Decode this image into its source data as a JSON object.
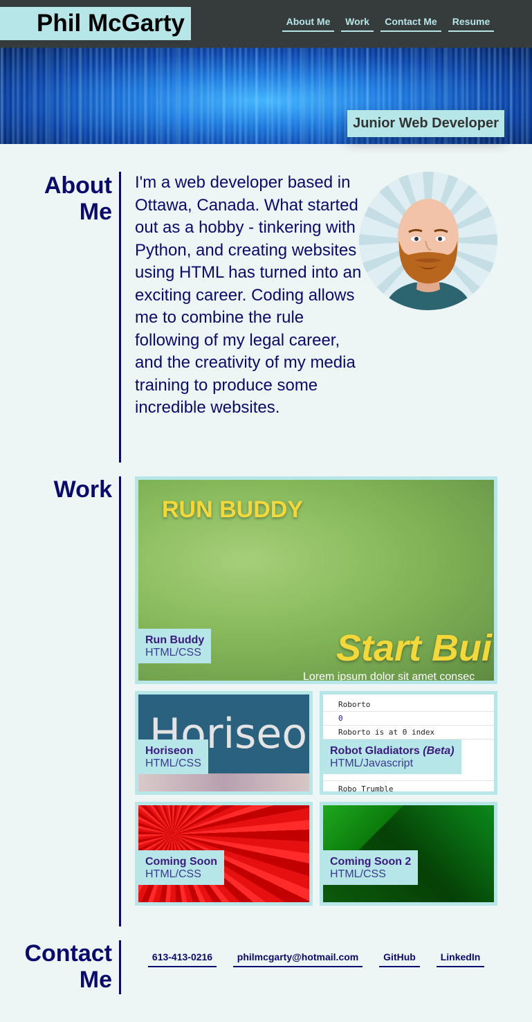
{
  "header": {
    "name": "Phil McGarty",
    "nav": [
      "About Me",
      "Work",
      "Contact Me",
      "Resume"
    ]
  },
  "hero": {
    "tagline": "Junior Web Developer"
  },
  "about": {
    "title_line1": "About",
    "title_line2": "Me",
    "text": "I'm a web developer based in Ottawa, Canada. What started out as a hobby - tinkering with Python, and creating websites using HTML has turned into an exciting career. Coding allows me to combine the rule following of my legal career, and the creativity of my media training to produce some incredible websites."
  },
  "work": {
    "title": "Work",
    "projects": [
      {
        "name": "Run Buddy",
        "tech": "HTML/CSS",
        "preview_title": "RUN BUDDY",
        "preview_cta": "Start Bui",
        "preview_sub": "Lorem ipsum dolor sit amet consec"
      },
      {
        "name": "Horiseon",
        "tech": "HTML/CSS",
        "preview_text": "Horiseon"
      },
      {
        "name": "Robot Gladiators",
        "name_suffix": "(Beta)",
        "tech": "HTML/Javascript",
        "preview_lines": [
          "Roborto",
          "0",
          "Roborto is at 0 index",
          "Robo Trumble"
        ]
      },
      {
        "name": "Coming Soon",
        "tech": "HTML/CSS"
      },
      {
        "name": "Coming Soon 2",
        "tech": "HTML/CSS"
      }
    ]
  },
  "contact": {
    "title_line1": "Contact",
    "title_line2": "Me",
    "links": [
      "613-413-0216",
      "philmcgarty@hotmail.com",
      "GitHub",
      "LinkedIn"
    ]
  }
}
